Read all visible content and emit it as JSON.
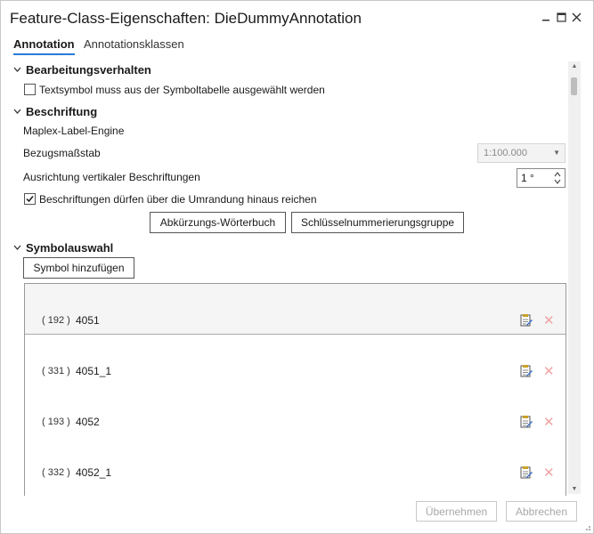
{
  "window": {
    "title": "Feature-Class-Eigenschaften: DieDummyAnnotation",
    "minimize_icon": "minimize-icon",
    "maximize_icon": "maximize-icon",
    "close_icon": "close-icon"
  },
  "tabs": [
    {
      "label": "Annotation",
      "active": true
    },
    {
      "label": "Annotationsklassen",
      "active": false
    }
  ],
  "editing": {
    "heading": "Bearbeitungsverhalten",
    "checkbox_label": "Textsymbol muss aus der Symboltabelle ausgewählt werden",
    "checked": false
  },
  "labeling": {
    "heading": "Beschriftung",
    "engine": "Maplex-Label-Engine",
    "scale_label": "Bezugsmaßstab",
    "scale_value": "1:100.000",
    "orientation_label": "Ausrichtung vertikaler Beschriftungen",
    "orientation_value": "1 °",
    "overflow_label": "Beschriftungen dürfen über die Umrandung hinaus reichen",
    "overflow_checked": true,
    "abbrev_button": "Abkürzungs-Wörterbuch",
    "key_button": "Schlüsselnummerierungsgruppe"
  },
  "symbols": {
    "heading": "Symbolauswahl",
    "add_button": "Symbol hinzufügen",
    "items": [
      {
        "id": "( 192 )",
        "name": "4051"
      },
      {
        "id": "( 331 )",
        "name": "4051_1"
      },
      {
        "id": "( 193 )",
        "name": "4052"
      },
      {
        "id": "( 332 )",
        "name": "4052_1"
      }
    ]
  },
  "footer": {
    "apply_label": "Übernehmen",
    "cancel_label": "Abbrechen"
  },
  "colors": {
    "accent": "#2b7bd6",
    "delete": "#f0a3a3"
  }
}
